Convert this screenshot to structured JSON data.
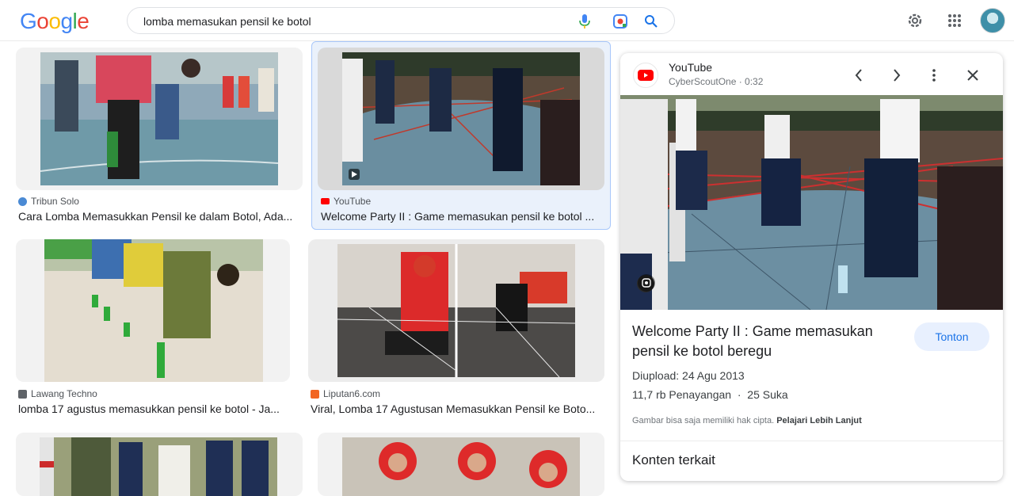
{
  "header": {
    "logo": [
      "G",
      "o",
      "o",
      "g",
      "l",
      "e"
    ],
    "logo_colors": [
      "#4285F4",
      "#EA4335",
      "#FBBC05",
      "#4285F4",
      "#34A853",
      "#EA4335"
    ],
    "search_query": "lomba memasukan pensil ke botol"
  },
  "results": [
    {
      "source": "Tribun Solo",
      "source_icon": "globe-icon",
      "title": "Cara Lomba Memasukkan Pensil ke dalam Botol, Ada..."
    },
    {
      "source": "YouTube",
      "source_icon": "youtube-icon",
      "title": "Welcome Party II : Game memasukan pensil ke botol ..."
    },
    {
      "source": "Lawang Techno",
      "source_icon": "site-icon",
      "title": "lomba 17 agustus memasukkan pensil ke botol - Ja..."
    },
    {
      "source": "Liputan6.com",
      "source_icon": "liputan6-icon",
      "title": "Viral, Lomba 17 Agustusan Memasukkan Pensil ke Boto..."
    }
  ],
  "panel": {
    "source": "YouTube",
    "meta": "CyberScoutOne · 0:32",
    "title": "Welcome Party II : Game memasukan pensil ke botol beregu",
    "watch_label": "Tonton",
    "upload": "Diupload: 24 Agu 2013",
    "stats": "11,7 rb Penayangan  ·  25 Suka",
    "copyright": "Gambar bisa saja memiliki hak cipta.",
    "learn_more": "Pelajari Lebih Lanjut",
    "related": "Konten terkait"
  },
  "colors": {
    "accent": "#1a73e8",
    "youtube_red": "#ff0000",
    "selected_border": "#a8c7fa"
  }
}
